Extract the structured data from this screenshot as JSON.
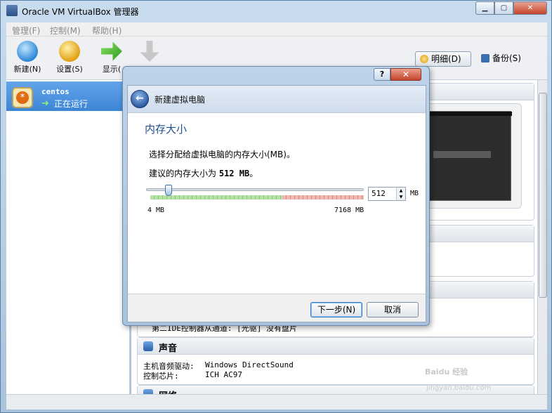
{
  "window": {
    "title": "Oracle VM VirtualBox 管理器",
    "min": "▁",
    "max": "▢",
    "close": "✕"
  },
  "menu": [
    "管理(F)",
    "控制(M)",
    "帮助(H)"
  ],
  "toolbar": {
    "new": "新建(N)",
    "settings": "设置(S)",
    "show": "显示(",
    "details": "明细(D)",
    "snapshots": "备份(S)"
  },
  "vm": {
    "name": "centos",
    "state": "正在运行"
  },
  "details_sections": {
    "storage_partial": "第二IDE控制器从通道:  [光驱] 没有盘片",
    "audio": {
      "title": "声音",
      "rows": [
        {
          "key": "主机音频驱动:",
          "value": "Windows DirectSound"
        },
        {
          "key": "控制芯片:",
          "value": "ICH AC97"
        }
      ]
    },
    "network": {
      "title": "网络"
    }
  },
  "dialog": {
    "title": "新建虚拟电脑",
    "help": "?",
    "close": "✕",
    "page_heading": "内存大小",
    "description": "选择分配给虚拟电脑的内存大小(MB)。",
    "recommend_prefix": "建议的内存大小为",
    "recommend_value": "512 MB",
    "recommend_suffix": "。",
    "slider_min": "4 MB",
    "slider_max": "7168 MB",
    "memory_value": "512",
    "unit": "MB",
    "slider_fraction": 0.071,
    "next": "下一步(N)",
    "cancel": "取消"
  },
  "watermark": {
    "text": "Baidu 经验",
    "url": "jingyan.baidu.com"
  },
  "colors": {
    "accent": "#3d85d5",
    "heading": "#1f4f8f",
    "titlebar": "#bed3ea"
  }
}
